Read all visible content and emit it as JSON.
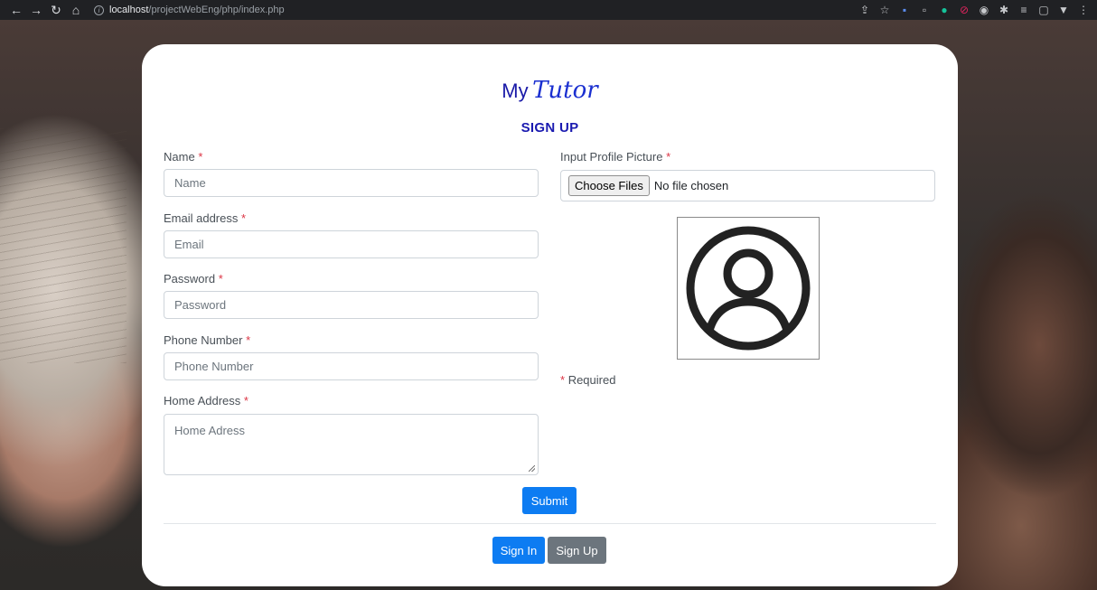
{
  "browser": {
    "url_host": "localhost",
    "url_path": "/projectWebEng/php/index.php"
  },
  "brand": {
    "logo_my": "My",
    "logo_tutor": "Tutor"
  },
  "form": {
    "title": "SIGN UP",
    "required_mark": "*",
    "name": {
      "label": "Name",
      "placeholder": "Name"
    },
    "email": {
      "label": "Email address",
      "placeholder": "Email"
    },
    "password": {
      "label": "Password",
      "placeholder": "Password"
    },
    "phone": {
      "label": "Phone Number",
      "placeholder": "Phone Number"
    },
    "address": {
      "label": "Home Address",
      "placeholder": "Home Adress"
    },
    "profile_picture": {
      "label": "Input Profile Picture",
      "button": "Choose Files",
      "status": "No file chosen"
    },
    "required_note": "Required",
    "submit": "Submit"
  },
  "footer": {
    "sign_in": "Sign In",
    "sign_up": "Sign Up"
  },
  "colors": {
    "primary": "#0d7cf2",
    "secondary": "#6c757d",
    "brand": "#1a1ab0",
    "required": "#dc3545"
  }
}
